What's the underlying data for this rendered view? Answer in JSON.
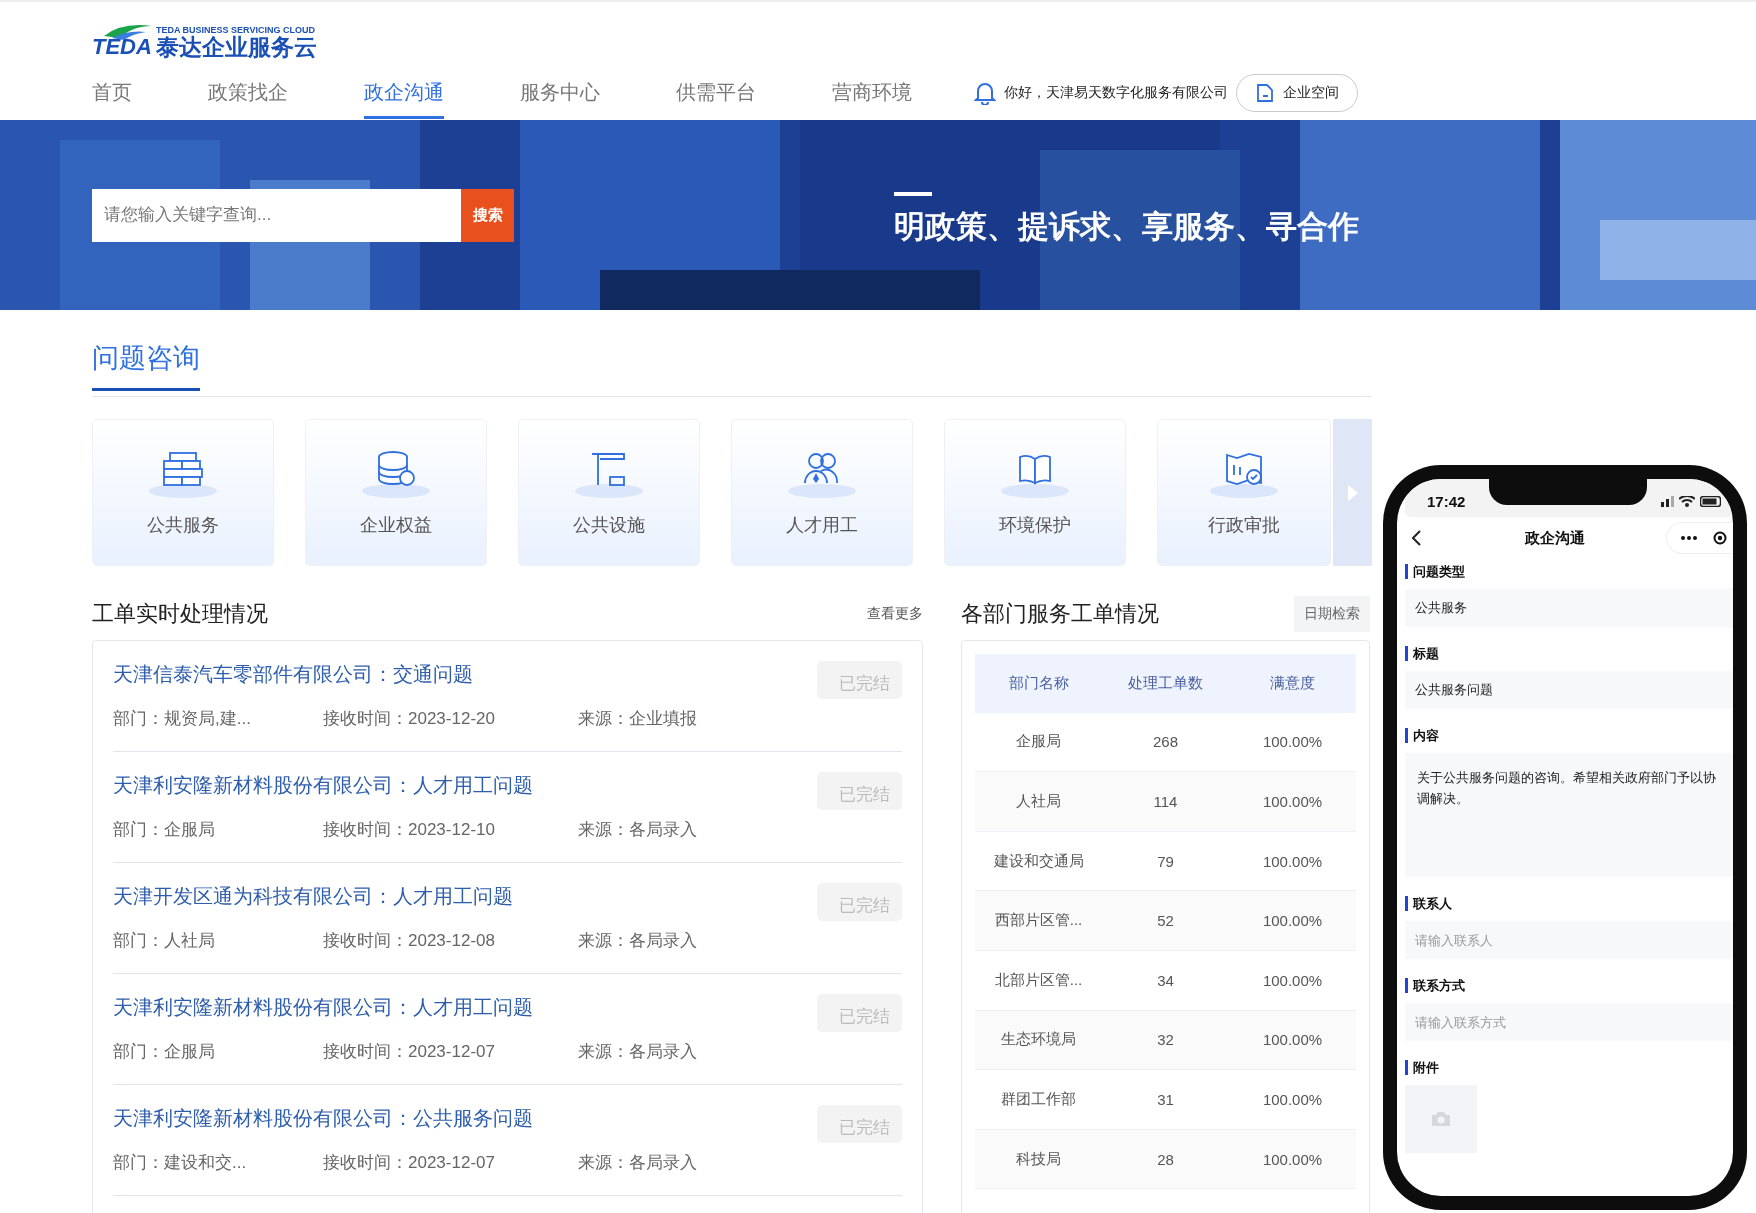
{
  "logo": {
    "mark": "TEDA",
    "subtitle": "TEDA BUSINESS SERVICING CLOUD",
    "name": "泰达企业服务云"
  },
  "nav": [
    {
      "label": "首页",
      "selected": false
    },
    {
      "label": "政策找企",
      "selected": false
    },
    {
      "label": "政企沟通",
      "selected": true
    },
    {
      "label": "服务中心",
      "selected": false
    },
    {
      "label": "供需平台",
      "selected": false
    },
    {
      "label": "营商环境",
      "selected": false
    }
  ],
  "user": {
    "greeting": "你好，天津易天数字化服务有限公司",
    "space_button": "企业空间"
  },
  "banner": {
    "search_placeholder": "请您输入关键字查询...",
    "search_button": "搜索",
    "slogan": "明政策、提诉求、享服务、寻合作"
  },
  "section_title": "问题咨询",
  "categories": [
    {
      "label": "公共服务",
      "kind": "bricks"
    },
    {
      "label": "企业权益",
      "kind": "coins"
    },
    {
      "label": "公共设施",
      "kind": "desk"
    },
    {
      "label": "人才用工",
      "kind": "people"
    },
    {
      "label": "环境保护",
      "kind": "book"
    },
    {
      "label": "行政审批",
      "kind": "map"
    }
  ],
  "orders": {
    "title": "工单实时处理情况",
    "more": "查看更多",
    "items": [
      {
        "title": "天津信泰汽车零部件有限公司：交通问题",
        "dept": "部门：规资局,建...",
        "time": "接收时间：2023-12-20",
        "source": "来源：企业填报",
        "status": "已完结"
      },
      {
        "title": "天津利安隆新材料股份有限公司：人才用工问题",
        "dept": "部门：企服局",
        "time": "接收时间：2023-12-10",
        "source": "来源：各局录入",
        "status": "已完结"
      },
      {
        "title": "天津开发区通为科技有限公司：人才用工问题",
        "dept": "部门：人社局",
        "time": "接收时间：2023-12-08",
        "source": "来源：各局录入",
        "status": "已完结"
      },
      {
        "title": "天津利安隆新材料股份有限公司：人才用工问题",
        "dept": "部门：企服局",
        "time": "接收时间：2023-12-07",
        "source": "来源：各局录入",
        "status": "已完结"
      },
      {
        "title": "天津利安隆新材料股份有限公司：公共服务问题",
        "dept": "部门：建设和交...",
        "time": "接收时间：2023-12-07",
        "source": "来源：各局录入",
        "status": "已完结"
      }
    ]
  },
  "departments": {
    "title": "各部门服务工单情况",
    "date_button": "日期检索",
    "columns": [
      "部门名称",
      "处理工单数",
      "满意度"
    ],
    "rows": [
      [
        "企服局",
        "268",
        "100.00%"
      ],
      [
        "人社局",
        "114",
        "100.00%"
      ],
      [
        "建设和交通局",
        "79",
        "100.00%"
      ],
      [
        "西部片区管...",
        "52",
        "100.00%"
      ],
      [
        "北部片区管...",
        "34",
        "100.00%"
      ],
      [
        "生态环境局",
        "32",
        "100.00%"
      ],
      [
        "群团工作部",
        "31",
        "100.00%"
      ],
      [
        "科技局",
        "28",
        "100.00%"
      ]
    ]
  },
  "phone": {
    "time": "17:42",
    "title": "政企沟通",
    "fields": [
      {
        "kind": "input",
        "label": "问题类型",
        "value": "公共服务"
      },
      {
        "kind": "input",
        "label": "标题",
        "value": "公共服务问题"
      },
      {
        "kind": "textarea",
        "label": "内容",
        "value": "关于公共服务问题的咨询。希望相关政府部门予以协调解决。"
      },
      {
        "kind": "input",
        "label": "联系人",
        "placeholder": "请输入联系人"
      },
      {
        "kind": "input",
        "label": "联系方式",
        "placeholder": "请输入联系方式"
      },
      {
        "kind": "upload",
        "label": "附件"
      }
    ]
  }
}
